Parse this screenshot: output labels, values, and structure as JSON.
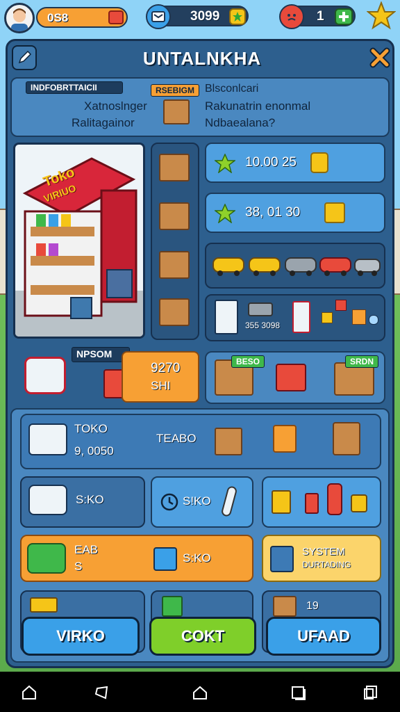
{
  "colors": {
    "panel_bg": "#2d5f8e",
    "card_bg": "#4a90cc",
    "orange": "#f7a034",
    "green": "#7fcf2a",
    "blue_button": "#3aa0e8",
    "gold": "#f5c518"
  },
  "topbar": {
    "coins_value": "0S8",
    "tickets_value": "3099",
    "lives_value": "1"
  },
  "header": {
    "title": "UNTALNKHA"
  },
  "info": {
    "tag_left": "INDFOBRTTAICII",
    "tag_center": "RSEBIGM",
    "left_line1": "Xatnoslnger",
    "left_line2": "Ralitagainor",
    "right_line1": "Blsconlcari",
    "right_line2": "Rakunatrin enonmal",
    "right_line3": "Ndbaealana?"
  },
  "shop": {
    "sign_line1": "Toko",
    "sign_line2": "VIRIUO"
  },
  "stats": {
    "row1_value": "10.00 25",
    "row2_value": "38, 01 30",
    "items_count": "355 3098"
  },
  "promo": {
    "label": "NPSOM",
    "price_line1": "9270",
    "price_line2": "SHI",
    "badge_left": "BESO",
    "badge_right": "SRDN"
  },
  "toko_panel": {
    "name": "TOKO",
    "value": "9, 0050",
    "center_label": "TEABO"
  },
  "row_a": {
    "card1_label": "S:KO",
    "card2_label": "S!KO"
  },
  "row_b": {
    "orange_line1": "EAB",
    "orange_line2": "S",
    "orange_value": "S:KO",
    "system_line1": "SYSTEM",
    "system_line2": "DURTADING"
  },
  "row_c": {
    "right_value": "19"
  },
  "buttons": {
    "left": "VIRKO",
    "center": "COKT",
    "right": "UFAAD"
  }
}
